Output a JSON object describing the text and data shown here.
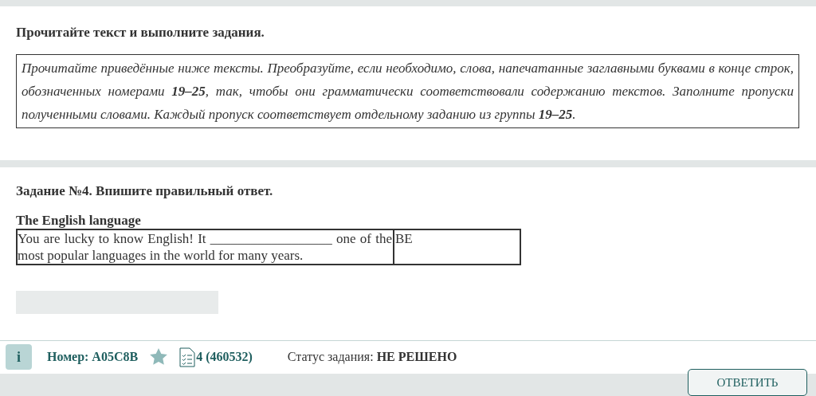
{
  "intro": {
    "heading": "Прочитайте текст и выполните задания.",
    "instruction": "Прочитайте приведённые ниже тексты. Преобразуйте, если необходимо, слова, напечатанные  заглавными буквами в конце строк, обозначенных номерами **19–25**, так, чтобы они грамматически соответствовали содержанию текстов. Заполните пропуски полученными словами. Каждый пропуск соответствует отдельному заданию из группы **19–25**."
  },
  "task": {
    "heading": "Задание №4. Впишите правильный ответ.",
    "title": "The English language",
    "sentence": "You are lucky to know English! It __________________ one of the most popular languages in the world for many years.",
    "keyword": "BE"
  },
  "footer": {
    "info_button": "i",
    "number": "Номер: A05C8B",
    "variant": "4 (460532)",
    "status_label": "Статус задания:",
    "status_value": "НЕ РЕШЕНО",
    "submit_button": "ОТВЕТИТЬ"
  }
}
